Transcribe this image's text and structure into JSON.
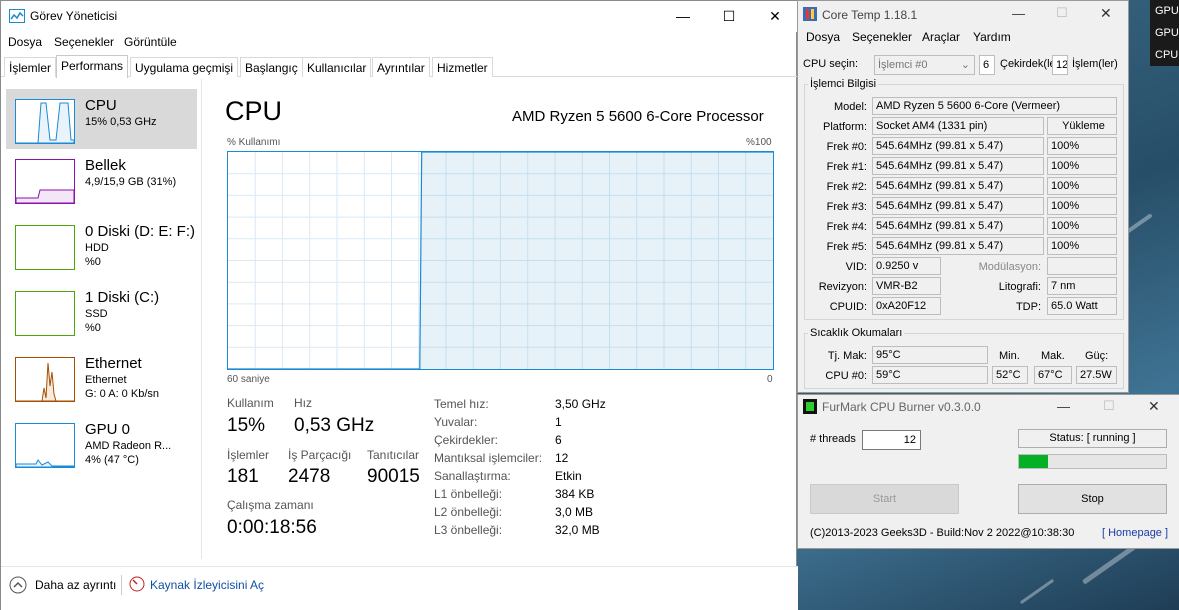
{
  "desktop": {
    "side_items": [
      "GPU",
      "GPU",
      "CPU"
    ]
  },
  "taskmgr": {
    "title": "Görev Yöneticisi",
    "menu": [
      "Dosya",
      "Seçenekler",
      "Görüntüle"
    ],
    "tabs": [
      "İşlemler",
      "Performans",
      "Uygulama geçmişi",
      "Başlangıç",
      "Kullanıcılar",
      "Ayrıntılar",
      "Hizmetler"
    ],
    "active_tab": "Performans",
    "resources": [
      {
        "name": "CPU",
        "lines": [
          "15%  0,53 GHz"
        ],
        "color": "#1a8ad4"
      },
      {
        "name": "Bellek",
        "lines": [
          "4,9/15,9 GB (31%)"
        ],
        "color": "#8b12ae"
      },
      {
        "name": "0 Diski (D: E: F:)",
        "lines": [
          "HDD",
          "%0"
        ],
        "color": "#4da60c"
      },
      {
        "name": "1 Diski (C:)",
        "lines": [
          "SSD",
          "%0"
        ],
        "color": "#4da60c"
      },
      {
        "name": "Ethernet",
        "lines": [
          "Ethernet",
          "G: 0 A: 0 Kb/sn"
        ],
        "color": "#a74f01"
      },
      {
        "name": "GPU 0",
        "lines": [
          "AMD Radeon R...",
          "4% (47 °C)"
        ],
        "color": "#1a8ad4"
      }
    ],
    "cpu": {
      "heading": "CPU",
      "model": "AMD Ryzen 5 5600 6-Core Processor",
      "graph_label_top_left": "% Kullanımı",
      "graph_label_top_right": "%100",
      "graph_label_bottom_left": "60 saniye",
      "graph_label_bottom_right": "0",
      "usage_history": [
        0,
        0,
        0,
        0,
        0,
        0,
        0,
        0,
        0,
        0,
        0,
        0,
        0,
        0,
        0,
        0,
        0,
        0,
        0,
        0,
        0,
        0,
        0,
        0,
        0,
        0,
        0,
        0,
        0,
        0,
        0,
        0,
        0,
        0,
        0,
        0,
        0,
        0,
        0,
        0,
        0,
        0,
        0,
        0,
        0,
        0,
        0,
        0,
        0,
        0,
        0,
        0,
        0,
        0,
        0,
        0,
        0,
        0,
        0,
        0,
        0,
        0,
        0,
        0,
        0,
        0,
        0,
        0,
        0,
        0,
        0,
        0,
        0,
        0,
        0,
        0,
        0,
        0,
        0,
        0,
        0,
        0,
        0,
        0,
        0,
        0,
        0,
        0,
        0,
        0,
        0,
        0,
        0,
        0,
        0,
        0,
        0,
        0,
        0,
        0,
        0,
        0,
        100,
        100,
        100,
        100,
        100,
        100,
        100,
        100,
        100,
        100,
        100,
        100,
        100,
        100,
        100,
        100,
        100,
        100,
        100,
        100,
        100,
        100,
        100,
        100,
        100,
        100,
        100,
        100,
        100,
        100,
        100,
        100,
        100,
        100,
        100,
        100,
        100,
        100,
        100,
        100,
        100,
        100,
        100,
        100,
        100,
        100,
        100,
        100,
        100,
        100,
        100,
        100,
        100,
        100,
        100,
        100,
        100,
        100,
        100,
        100,
        100,
        100,
        100,
        100,
        100,
        100,
        100,
        100,
        100,
        100,
        100,
        100,
        100,
        100,
        100,
        100,
        100,
        100,
        100,
        100,
        100,
        100,
        100,
        100,
        100,
        100,
        100,
        100,
        100,
        100,
        100,
        100,
        100,
        100,
        100,
        100,
        100,
        100,
        100,
        100,
        100,
        100,
        100,
        100,
        100,
        100,
        100,
        100,
        100,
        100,
        100,
        100,
        100,
        100,
        100,
        100,
        100,
        100,
        100,
        100,
        100,
        100,
        100,
        100,
        100,
        100,
        100,
        100,
        100,
        100,
        100,
        100,
        100,
        100,
        100,
        100,
        100,
        100,
        100,
        100,
        100,
        100,
        100,
        100,
        100,
        100,
        100,
        100,
        100,
        100,
        100,
        100,
        100,
        100,
        100,
        100,
        100,
        100,
        100,
        100,
        100,
        100,
        100,
        100,
        100,
        100,
        100,
        100,
        100,
        100,
        100,
        100,
        100,
        100,
        100,
        100,
        100,
        100,
        100,
        100,
        100,
        100,
        100,
        100,
        100,
        100
      ],
      "usage_label": "Kullanım",
      "usage_value": "15%",
      "speed_label": "Hız",
      "speed_value": "0,53 GHz",
      "processes_label": "İşlemler",
      "processes_value": "181",
      "threads_label": "İş Parçacığı",
      "threads_value": "2478",
      "handles_label": "Tanıtıcılar",
      "handles_value": "90015",
      "uptime_label": "Çalışma zamanı",
      "uptime_value": "0:00:18:56",
      "specs": [
        {
          "k": "Temel hız:",
          "v": "3,50 GHz"
        },
        {
          "k": "Yuvalar:",
          "v": "1"
        },
        {
          "k": "Çekirdekler:",
          "v": "6"
        },
        {
          "k": "Mantıksal işlemciler:",
          "v": "12"
        },
        {
          "k": "Sanallaştırma:",
          "v": "Etkin"
        },
        {
          "k": "L1 önbelleği:",
          "v": "384 KB"
        },
        {
          "k": "L2 önbelleği:",
          "v": "3,0 MB"
        },
        {
          "k": "L3 önbelleği:",
          "v": "32,0 MB"
        }
      ]
    },
    "footer": {
      "less_details": "Daha az ayrıntı",
      "open_monitor": "Kaynak İzleyicisini Aç"
    }
  },
  "coretemp": {
    "title": "Core Temp 1.18.1",
    "menu": [
      "Dosya",
      "Seçenekler",
      "Araçlar",
      "Yardım"
    ],
    "cpu_select_label": "CPU seçin:",
    "cpu_select_value": "İşlemci #0",
    "cores_value": "6",
    "cores_label": "Çekirdek(le",
    "threads_value": "12",
    "threads_label": "İşlem(ler)",
    "info_group": "İşlemci Bilgisi",
    "model_label": "Model:",
    "model_value": "AMD Ryzen 5 5600 6-Core (Vermeer)",
    "platform_label": "Platform:",
    "platform_value": "Socket AM4 (1331 pin)",
    "load_header": "Yükleme",
    "freqs": [
      {
        "label": "Frek #0:",
        "value": "545.64MHz (99.81 x 5.47)",
        "load": "100%"
      },
      {
        "label": "Frek #1:",
        "value": "545.64MHz (99.81 x 5.47)",
        "load": "100%"
      },
      {
        "label": "Frek #2:",
        "value": "545.64MHz (99.81 x 5.47)",
        "load": "100%"
      },
      {
        "label": "Frek #3:",
        "value": "545.64MHz (99.81 x 5.47)",
        "load": "100%"
      },
      {
        "label": "Frek #4:",
        "value": "545.64MHz (99.81 x 5.47)",
        "load": "100%"
      },
      {
        "label": "Frek #5:",
        "value": "545.64MHz (99.81 x 5.47)",
        "load": "100%"
      }
    ],
    "vid_label": "VID:",
    "vid_value": "0.9250 v",
    "modulation_label": "Modülasyon:",
    "revision_label": "Revizyon:",
    "revision_value": "VMR-B2",
    "lithography_label": "Litografi:",
    "lithography_value": "7 nm",
    "cpuid_label": "CPUID:",
    "cpuid_value": "0xA20F12",
    "tdp_label": "TDP:",
    "tdp_value": "65.0 Watt",
    "temp_group": "Sıcaklık Okumaları",
    "tjmax_label": "Tj. Mak:",
    "tjmax_value": "95°C",
    "min_header": "Min.",
    "max_header": "Mak.",
    "power_header": "Güç:",
    "cpu0_label": "CPU #0:",
    "cpu0_value": "59°C",
    "cpu0_min": "52°C",
    "cpu0_max": "67°C",
    "cpu0_power": "27.5W"
  },
  "furmark": {
    "title": "FurMark CPU Burner v0.3.0.0",
    "threads_label": "# threads",
    "threads_value": "12",
    "status": "Status: [ running ]",
    "progress": 0.2,
    "start_label": "Start",
    "stop_label": "Stop",
    "footer_text": "(C)2013-2023 Geeks3D - Build:Nov  2 2022@10:38:30",
    "homepage_label": "[ Homepage ]"
  }
}
